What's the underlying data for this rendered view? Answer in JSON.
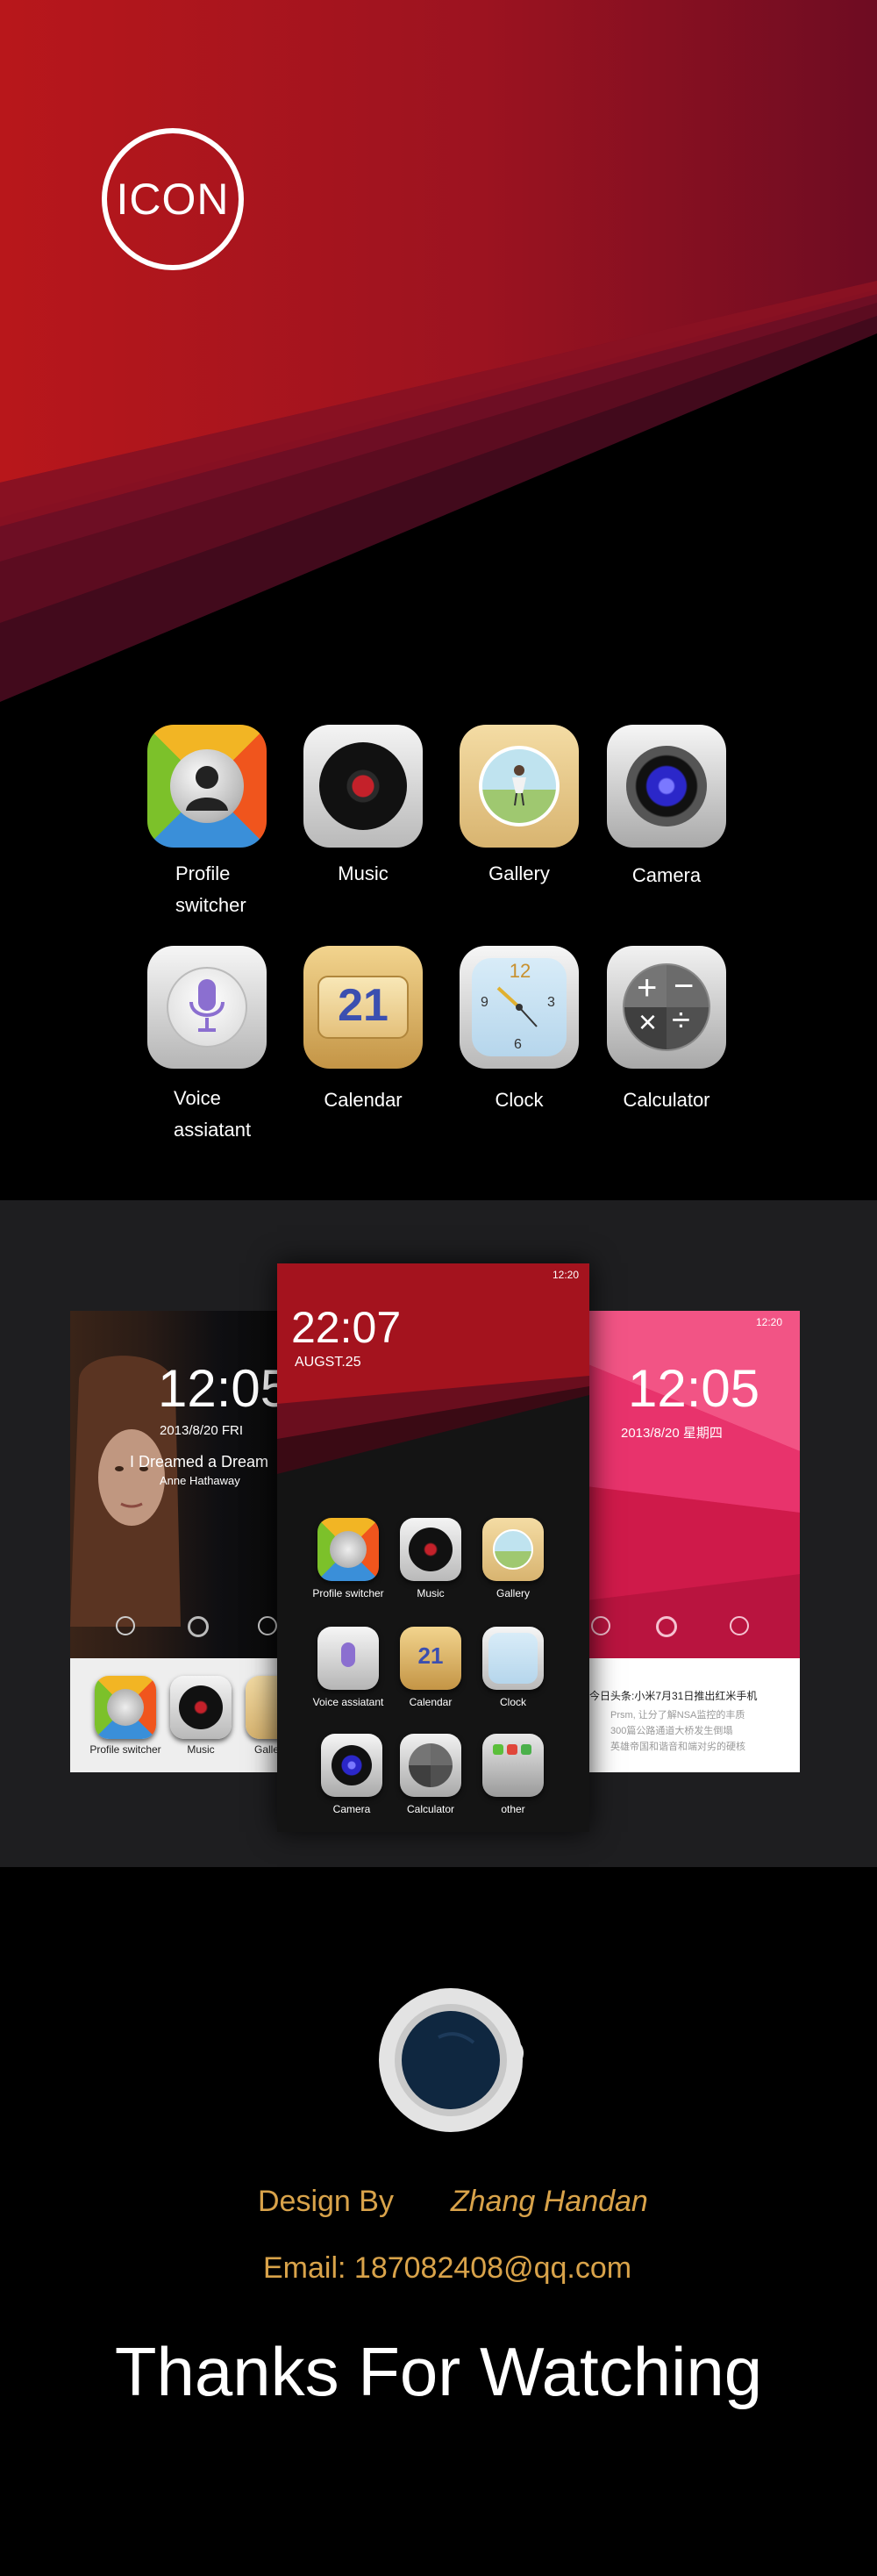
{
  "hero": {
    "logo_text": "ICON"
  },
  "icons": [
    {
      "name": "profile-switcher",
      "label_lines": [
        "Profile",
        "switcher"
      ]
    },
    {
      "name": "music",
      "label_lines": [
        "Music"
      ]
    },
    {
      "name": "gallery",
      "label_lines": [
        "Gallery"
      ]
    },
    {
      "name": "camera",
      "label_lines": [
        "Camera"
      ]
    },
    {
      "name": "voice-assistant",
      "label_lines": [
        "Voice",
        "assiatant"
      ]
    },
    {
      "name": "calendar",
      "label_lines": [
        "Calendar"
      ],
      "date": "21"
    },
    {
      "name": "clock",
      "label_lines": [
        "Clock"
      ],
      "numerals": [
        "12",
        "3",
        "6",
        "9"
      ]
    },
    {
      "name": "calculator",
      "label_lines": [
        "Calculator"
      ]
    }
  ],
  "phones": {
    "center": {
      "status_time": "12:20",
      "time": "22:07",
      "date": "AUGST.25",
      "apps": [
        {
          "label": "Profile switcher"
        },
        {
          "label": "Music"
        },
        {
          "label": "Gallery"
        },
        {
          "label": "Voice assiatant"
        },
        {
          "label": "Calendar",
          "date": "21"
        },
        {
          "label": "Clock"
        },
        {
          "label": "Camera"
        },
        {
          "label": "Calculator"
        },
        {
          "label": "other"
        }
      ]
    },
    "left": {
      "time": "12:05",
      "date": "2013/8/20 FRI",
      "song": "I Dreamed a Dream",
      "artist": "Anne Hathaway",
      "dock": [
        {
          "label": "Profile switcher"
        },
        {
          "label": "Music"
        },
        {
          "label": "Galle"
        }
      ]
    },
    "right": {
      "status_time": "12:20",
      "time": "12:05",
      "date": "2013/8/20 星期四",
      "news_title": "今日头条:小米7月31日推出红米手机",
      "news_lines": [
        "Prsm, 让分了解NSA监控的丰质",
        "300篇公路通道大桥发生倒塌",
        "英雄帝国和谐音和端对劣的硬核"
      ]
    }
  },
  "footer": {
    "design_by_label": "Design By",
    "designer": "Zhang Handan",
    "email": "Email: 187082408@qq.com",
    "thanks": "Thanks For Watching"
  },
  "colors": {
    "accent_red": "#b3171d",
    "gold": "#d9a34a",
    "band": "#1e1e20"
  }
}
